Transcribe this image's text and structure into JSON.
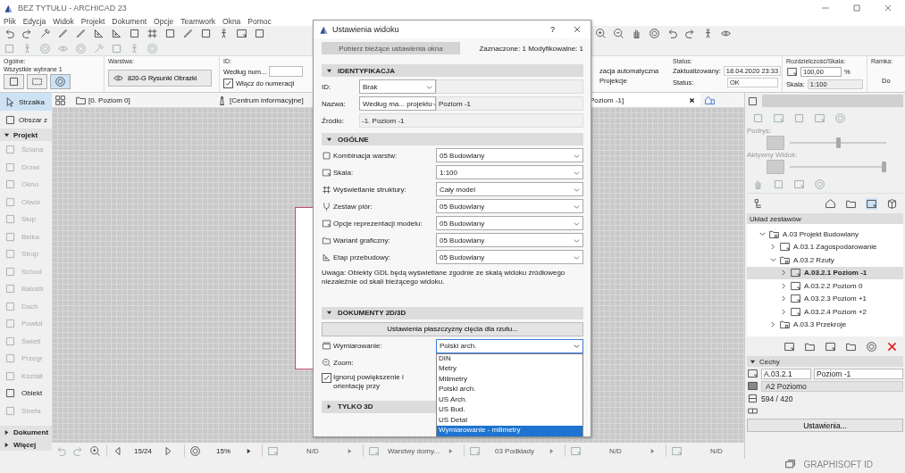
{
  "app": {
    "title": "BEZ TYTUŁU - ARCHICAD 23"
  },
  "menu": [
    "Plik",
    "Edycja",
    "Widok",
    "Projekt",
    "Dokument",
    "Opcje",
    "Teamwork",
    "Okna",
    "Pomoc"
  ],
  "info_box": {
    "general": {
      "label": "Ogólne:",
      "selection": "Wszystkie wybrane 1"
    },
    "layer": {
      "label": "Warstwa:",
      "value": "820-G Rysunki Obrazki"
    },
    "id": {
      "label": "ID:",
      "value": "Według num...",
      "checkbox": {
        "label": "Włącz do numeracji",
        "checked": true
      }
    },
    "column_4": [
      "zacja automatyczna",
      "Projekcje"
    ],
    "status": {
      "label": "Status:",
      "rows": [
        {
          "label": "Zaktualizowany:",
          "value": "18.04.2020 23:33"
        },
        {
          "label": "Status:",
          "value": "OK"
        }
      ]
    },
    "scale": {
      "label": "Rozdzielczość/Skala:",
      "value": "100,00",
      "unit": "%",
      "scale_label": "Skala:",
      "scale_value": "1:100"
    },
    "frame": {
      "label": "Ramka:",
      "value": "Do"
    }
  },
  "tabs": [
    {
      "label": "[0. Poziom 0]",
      "selected": false
    },
    {
      "label": "[Centrum informacyjne]",
      "selected": false
    },
    {
      "label": "Poziom -1]",
      "selected": true
    }
  ],
  "toolbox": {
    "tools": [
      {
        "label": "Strzałka",
        "selected": true
      },
      {
        "label": "Obszar z",
        "selected": false
      }
    ],
    "sections": [
      {
        "label": "Projekt",
        "expanded": true,
        "items": [
          {
            "label": "Ściana",
            "disabled": true
          },
          {
            "label": "Drzwi",
            "disabled": true
          },
          {
            "label": "Okno",
            "disabled": true
          },
          {
            "label": "Otwór",
            "disabled": true
          },
          {
            "label": "Słup",
            "disabled": true
          },
          {
            "label": "Belka",
            "disabled": true
          },
          {
            "label": "Strop",
            "disabled": true
          },
          {
            "label": "Schod",
            "disabled": true
          },
          {
            "label": "Balustr",
            "disabled": true
          },
          {
            "label": "Dach",
            "disabled": true
          },
          {
            "label": "Powłol",
            "disabled": true
          },
          {
            "label": "Świetl",
            "disabled": true
          },
          {
            "label": "Przegr",
            "disabled": true
          },
          {
            "label": "Kształt",
            "disabled": true
          },
          {
            "label": "Obiekt",
            "disabled": false
          },
          {
            "label": "Strefa",
            "disabled": true
          }
        ]
      },
      {
        "label": "Dokument",
        "expanded": false
      },
      {
        "label": "Więcej",
        "expanded": false
      }
    ]
  },
  "status_bar": {
    "page": "15/24",
    "zoom": "15%",
    "items": [
      "N/D",
      "Warstwy domy...",
      "03 Podkłady",
      "N/D",
      "N/D"
    ]
  },
  "navigator": {
    "sliders": [
      {
        "label": "Podrys:",
        "level": 0.5
      },
      {
        "label": "Aktywny Widok:",
        "level": 1
      }
    ],
    "tree": {
      "title": "Układ zestawów",
      "items": [
        {
          "kind": "folder",
          "label": "A.03 Projekt Budowlany",
          "expanded": true,
          "selected": false,
          "children": [
            {
              "kind": "layout",
              "label": "A.03.1 Zagospodarowanie",
              "expanded": false,
              "selected": false
            },
            {
              "kind": "folder",
              "label": "A.03.2 Rzuty",
              "expanded": true,
              "selected": false,
              "children": [
                {
                  "kind": "layout",
                  "label": "A.03.2.1 Poziom -1",
                  "expanded": false,
                  "selected": true
                },
                {
                  "kind": "layout",
                  "label": "A.03.2.2 Poziom 0",
                  "expanded": false,
                  "selected": false
                },
                {
                  "kind": "layout",
                  "label": "A.03.2.3 Poziom +1",
                  "expanded": false,
                  "selected": false
                },
                {
                  "kind": "layout",
                  "label": "A.03.2.4 Poziom +2",
                  "expanded": false,
                  "selected": false
                }
              ]
            },
            {
              "kind": "folder",
              "label": "A.03.3 Przekroje",
              "expanded": false,
              "selected": false
            }
          ]
        }
      ]
    }
  },
  "properties": {
    "title": "Cechy",
    "expanded": true,
    "number": "A.03.2.1",
    "name": "Poziom -1",
    "format": "A2 Poziomo",
    "size": "594 / 420",
    "button": "Ustawienia..."
  },
  "footer": {
    "account": "GRAPHISOFT ID"
  },
  "dialog": {
    "title": "Ustawienia widoku",
    "help": "?",
    "get_button": {
      "label": "Pobierz bieżące ustawienia okna",
      "disabled": true
    },
    "selection_info": "Zaznaczone: 1 Modyfikowalne: 1",
    "sections": [
      {
        "kind": "identification",
        "title": "IDENTYFIKACJA",
        "expanded": true,
        "rows": [
          {
            "label": "ID:",
            "select": "Brak"
          },
          {
            "label": "Nazwa:",
            "select": "Według ma... projektu",
            "value": "Poziom -1"
          },
          {
            "label": "Źródło:",
            "value": "-1. Poziom -1"
          }
        ]
      },
      {
        "kind": "general",
        "title": "OGÓLNE",
        "expanded": true,
        "rows": [
          {
            "label": "Kombinacja warstw:",
            "value": "05 Budowlany"
          },
          {
            "label": "Skala:",
            "value": "1:100"
          },
          {
            "label": "Wyświetlanie struktury:",
            "value": "Cały model"
          },
          {
            "label": "Zestaw piór:",
            "value": "05 Budowlany"
          },
          {
            "label": "Opcje reprezentacji modelu:",
            "value": "05 Budowlany"
          },
          {
            "label": "Wariant graficzny:",
            "value": "05 Budowlany"
          },
          {
            "label": "Etap przebudowy:",
            "value": "05 Budowlany"
          }
        ],
        "note": "Uwaga: Obiekty GDL będą wyświetlane zgodnie ze skalą widoku źródłowego niezależnie od skali bieżącego widoku."
      },
      {
        "kind": "documents",
        "title": "DOKUMENTY 2D/3D",
        "expanded": true,
        "button": "Ustawienia płaszczyzny cięcia dla rzutu...",
        "dimension": {
          "label": "Wymiarowanie:",
          "value": "Polski arch.",
          "open": true,
          "options": [
            {
              "label": "DIN",
              "highlighted": false
            },
            {
              "label": "Metry",
              "highlighted": false
            },
            {
              "label": "Milimetry",
              "highlighted": false
            },
            {
              "label": "Polski arch.",
              "highlighted": false
            },
            {
              "label": "US Arch.",
              "highlighted": false
            },
            {
              "label": "US Bud.",
              "highlighted": false
            },
            {
              "label": "US Detal",
              "highlighted": false
            },
            {
              "label": "Wymiarowanie - milimetry",
              "highlighted": true
            }
          ]
        },
        "zoom_label": "Zoom:",
        "checkbox": {
          "label": "Ignoruj powiększenie i orientację przy",
          "checked": true
        }
      },
      {
        "kind": "model",
        "title": "TYLKO 3D",
        "expanded": false
      }
    ]
  }
}
